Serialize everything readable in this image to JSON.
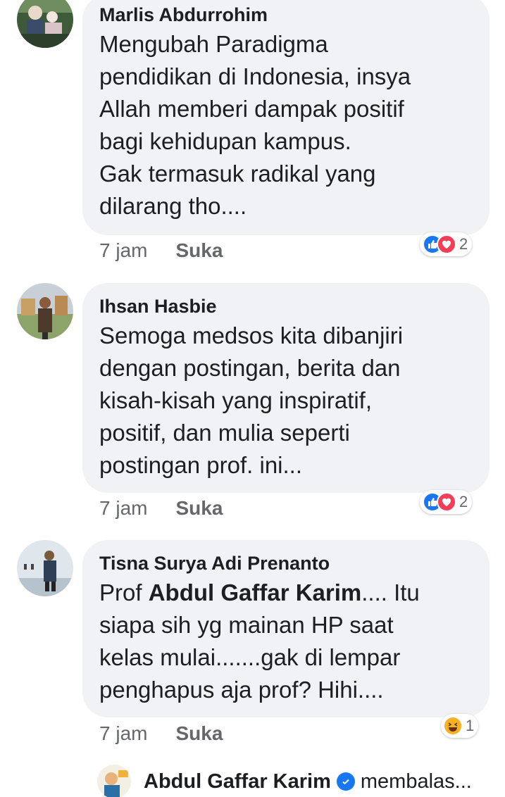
{
  "comments": [
    {
      "author": "Marlis Abdurrohim",
      "text_lines": [
        "Mengubah Paradigma",
        "pendidikan di Indonesia, insya",
        "Allah memberi dampak positif",
        "bagi kehidupan kampus.",
        "Gak termasuk radikal yang",
        "dilarang tho...."
      ],
      "time": "7 jam",
      "like_label": "Suka",
      "reaction_count": "2",
      "reactions": [
        "like-icon",
        "love-icon"
      ]
    },
    {
      "author": "Ihsan Hasbie",
      "text_lines": [
        "Semoga medsos kita dibanjiri",
        "dengan postingan, berita dan",
        "kisah-kisah yang inspiratif,",
        "positif, dan mulia seperti",
        "postingan prof. ini..."
      ],
      "time": "7 jam",
      "like_label": "Suka",
      "reaction_count": "2",
      "reactions": [
        "like-icon",
        "love-icon"
      ]
    },
    {
      "author": "Tisna Surya Adi Prenanto",
      "text_prefix": "Prof ",
      "text_mention": "Abdul Gaffar Karim",
      "text_line1_suffix": ".... Itu",
      "text_lines_rest": [
        "siapa sih yg mainan HP saat",
        "kelas mulai.......gak di lempar",
        "penghapus aja prof? Hihi...."
      ],
      "time": "7 jam",
      "like_label": "Suka",
      "reaction_count": "1",
      "reactions": [
        "haha-icon"
      ]
    }
  ],
  "reply": {
    "author": "Abdul Gaffar Karim",
    "action": "membalas..."
  },
  "colors": {
    "bubble": "#f0f2f5",
    "meta": "#65676b",
    "like_blue": "#1877f2",
    "love_red": "#f33e58",
    "haha_yellow": "#f7b125"
  }
}
